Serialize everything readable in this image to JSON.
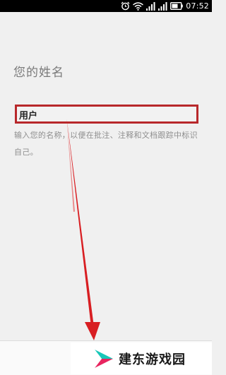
{
  "status_bar": {
    "time": "07:52",
    "icons": [
      "alarm-icon",
      "wifi-icon",
      "signal-icon",
      "signal-icon",
      "battery-icon"
    ]
  },
  "form": {
    "title": "您的姓名",
    "name_value": "用户",
    "hint": "输入您的名称，以便在批注、注释和文档跟踪中标识自己。"
  },
  "annotation": {
    "highlight_color": "#b8282b",
    "arrow_color": "#d81e22"
  },
  "watermark": {
    "text": "建东游戏园",
    "logo": "play-triangle-logo",
    "logo_colors": [
      "#18c7b8",
      "#e8255f"
    ]
  }
}
